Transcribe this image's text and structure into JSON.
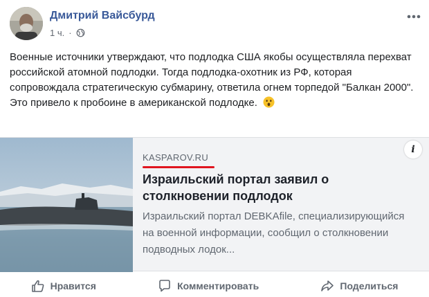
{
  "post": {
    "author": "Дмитрий Вайсбурд",
    "time": "1 ч.",
    "separator": "·",
    "text": "Военные источники утверждают, что подлодка США якобы осуществляла перехват российской атомной подлодки. Тогда подлодка-охотник из РФ, которая сопровождала стратегическую субмарину, ответила огнем торпедой \"Балкан 2000\". Это привело к пробоине в американской подлодке."
  },
  "link": {
    "domain": "KASPAROV.RU",
    "title": "Израильский портал заявил о столкновении подлодок",
    "description": "Израильский портал DEBKAfile, специализирующийся на военной информации, сообщил о столкновении подводных лодок...",
    "info_label": "i",
    "accent_color": "#e0141e"
  },
  "actions": {
    "like": "Нравится",
    "comment": "Комментировать",
    "share": "Поделиться"
  },
  "icons": [
    "globe-icon",
    "more-icon",
    "surprised-emoji-icon",
    "info-icon",
    "thumbs-up-icon",
    "comment-icon",
    "share-icon"
  ]
}
